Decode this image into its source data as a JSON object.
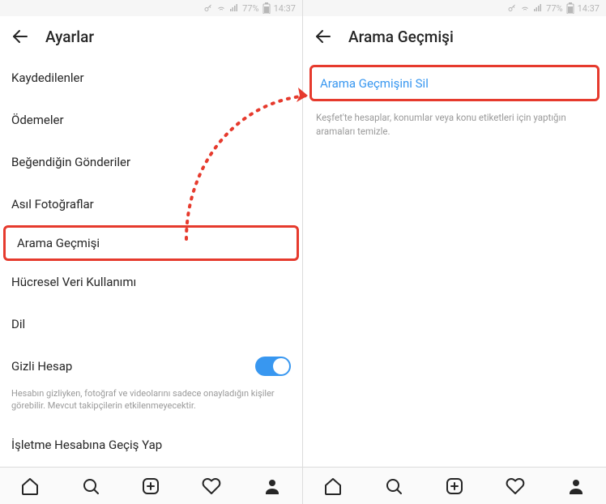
{
  "statusbar": {
    "battery": "77%",
    "time": "14:37"
  },
  "left": {
    "title": "Ayarlar",
    "items": {
      "saved": "Kaydedilenler",
      "payments": "Ödemeler",
      "liked": "Beğendiğin Gönderiler",
      "original": "Asıl Fotoğraflar",
      "search_history": "Arama Geçmişi",
      "cellular": "Hücresel Veri Kullanımı",
      "language": "Dil",
      "private": "Gizli Hesap",
      "business": "İşletme Hesabına Geçiş Yap"
    },
    "private_footnote": "Hesabın gizliyken, fotoğraf ve videolarını sadece onayladığın kişiler görebilir. Mevcut takipçilerin etkilenmeyecektir."
  },
  "right": {
    "title": "Arama Geçmişi",
    "clear_label": "Arama Geçmişini Sil",
    "clear_desc": "Keşfet'te hesaplar, konumlar veya konu etiketleri için yaptığın aramaları temizle."
  }
}
